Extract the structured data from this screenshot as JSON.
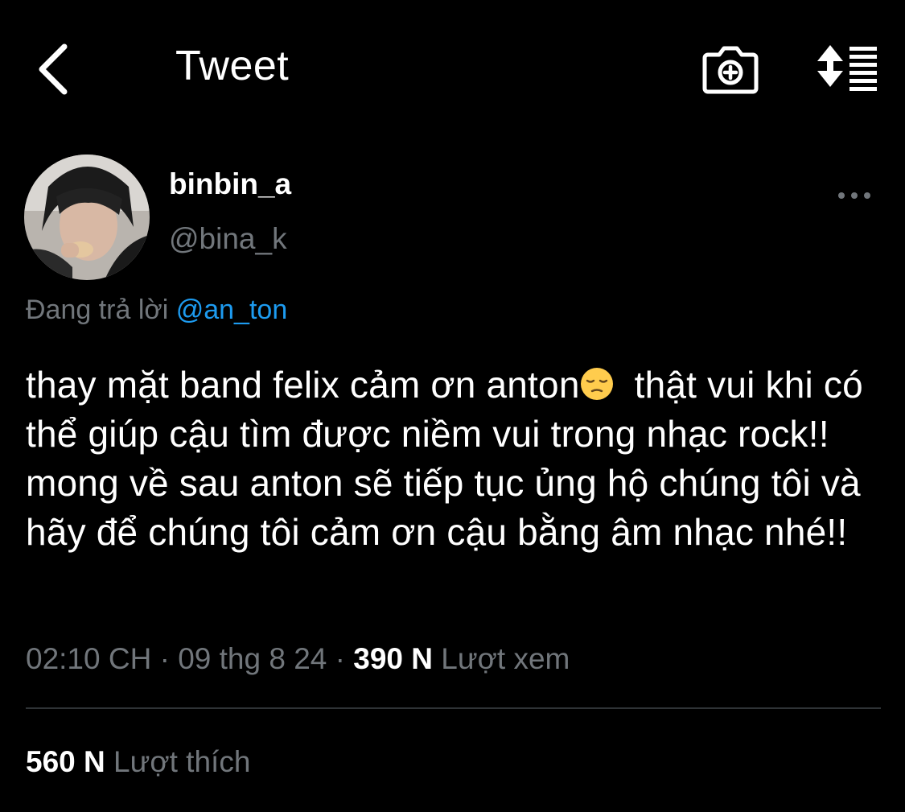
{
  "header": {
    "title": "Tweet",
    "back_icon": "chevron-left-icon",
    "camera_icon": "camera-plus-icon",
    "sort_icon": "sort-list-icon"
  },
  "tweet": {
    "display_name": "binbin_a",
    "handle": "@bina_k",
    "reply_prefix": "Đang trả lời",
    "reply_mention": "@an_ton",
    "text_part1": "thay mặt band felix cảm ơn anton",
    "emoji": "pensive-face-emoji",
    "text_part2": "thật vui khi có thể giúp cậu tìm được niềm vui trong nhạc rock!! mong về sau anton sẽ tiếp tục ủng hộ chúng tôi và hãy để chúng tôi cảm ơn cậu bằng âm nhạc nhé!!",
    "time": "02:10 CH",
    "sep": "·",
    "date": "09 thg 8 24",
    "views_count": "390 N",
    "views_label": "Lượt xem",
    "likes_count": "560 N",
    "likes_label": "Lượt thích"
  },
  "colors": {
    "background": "#000000",
    "text_primary": "#ffffff",
    "text_secondary": "#71767b",
    "link": "#1d9bf0",
    "divider": "#2f3336"
  }
}
